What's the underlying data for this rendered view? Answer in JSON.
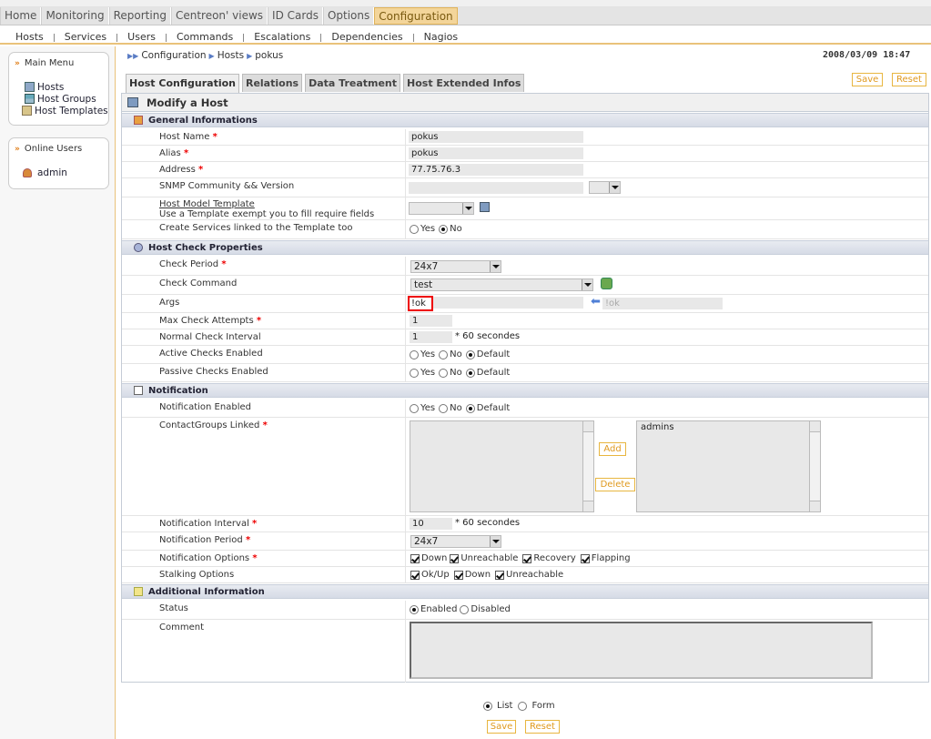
{
  "nav": {
    "tabs": [
      "Home",
      "Monitoring",
      "Reporting",
      "Centreon' views",
      "ID Cards",
      "Options",
      "Configuration"
    ],
    "active": "Configuration"
  },
  "subnav": [
    "Hosts",
    "Services",
    "Users",
    "Commands",
    "Escalations",
    "Dependencies",
    "Nagios"
  ],
  "main_menu": {
    "title": "Main Menu",
    "items": [
      "Hosts",
      "Host Groups",
      "Host Templates"
    ]
  },
  "online_users": {
    "title": "Online Users",
    "items": [
      "admin"
    ]
  },
  "breadcrumb": [
    "Configuration",
    "Hosts",
    "pokus"
  ],
  "date": "2008/03/09 18:47",
  "buttons": {
    "save": "Save",
    "reset": "Reset"
  },
  "content_tabs": [
    "Host Configuration",
    "Relations",
    "Data Treatment",
    "Host Extended Infos"
  ],
  "form": {
    "title": "Modify a Host",
    "sections": {
      "general": "General Informations",
      "check": "Host Check Properties",
      "notification": "Notification",
      "additional": "Additional Information"
    },
    "fields": {
      "host_name": {
        "label": "Host Name",
        "value": "pokus"
      },
      "alias": {
        "label": "Alias",
        "value": "pokus"
      },
      "address": {
        "label": "Address",
        "value": "77.75.76.3"
      },
      "snmp": {
        "label": "SNMP Community && Version"
      },
      "model": {
        "label": "Host Model Template",
        "hint": "Use a Template exempt you to fill require fields"
      },
      "create_services": {
        "label": "Create Services linked to the Template too",
        "opts": [
          "Yes",
          "No"
        ],
        "selected": "No"
      },
      "check_period": {
        "label": "Check Period",
        "value": "24x7"
      },
      "check_command": {
        "label": "Check Command",
        "value": "test"
      },
      "args": {
        "label": "Args",
        "value": "!ok",
        "copy_value": "!ok"
      },
      "max_attempts": {
        "label": "Max Check Attempts",
        "value": "1"
      },
      "normal_interval": {
        "label": "Normal Check Interval",
        "value": "1",
        "suffix": "* 60 secondes"
      },
      "active_checks": {
        "label": "Active Checks Enabled",
        "opts": [
          "Yes",
          "No",
          "Default"
        ],
        "selected": "Default"
      },
      "passive_checks": {
        "label": "Passive Checks Enabled",
        "opts": [
          "Yes",
          "No",
          "Default"
        ],
        "selected": "Default"
      },
      "notif_enabled": {
        "label": "Notification Enabled",
        "opts": [
          "Yes",
          "No",
          "Default"
        ],
        "selected": "Default"
      },
      "contactgroups": {
        "label": "ContactGroups Linked",
        "add": "Add",
        "delete": "Delete",
        "linked": [
          "admins"
        ]
      },
      "notif_interval": {
        "label": "Notification Interval",
        "value": "10",
        "suffix": "* 60 secondes"
      },
      "notif_period": {
        "label": "Notification Period",
        "value": "24x7"
      },
      "notif_options": {
        "label": "Notification Options",
        "opts": [
          "Down",
          "Unreachable",
          "Recovery",
          "Flapping"
        ]
      },
      "stalking": {
        "label": "Stalking Options",
        "opts": [
          "Ok/Up",
          "Down",
          "Unreachable"
        ]
      },
      "status": {
        "label": "Status",
        "opts": [
          "Enabled",
          "Disabled"
        ],
        "selected": "Enabled"
      },
      "comment": {
        "label": "Comment"
      }
    }
  },
  "footer": {
    "opts": [
      "List",
      "Form"
    ],
    "selected": "List"
  }
}
